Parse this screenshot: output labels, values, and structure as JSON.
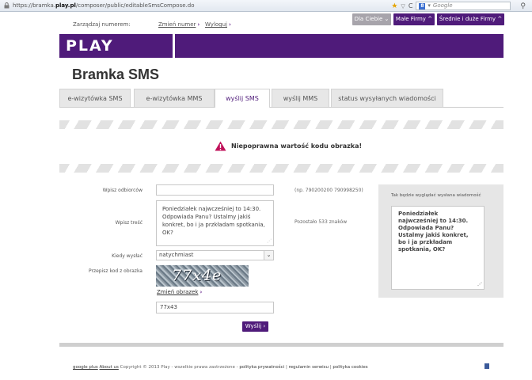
{
  "browser": {
    "url_prefix": "https://bramka.",
    "url_host": "play.pl",
    "url_path": "/composer/public/editableSmsCompose.do",
    "search_placeholder": "Google",
    "search_badge": "8"
  },
  "utility": {
    "manage_label": "Zarządzaj numerem:",
    "change_number": "Zmień numer",
    "logout": "Wyloguj",
    "segments": [
      "Dla Ciebie",
      "Małe Firmy",
      "Średnie i duże Firmy"
    ]
  },
  "brand": {
    "logo_text": "PLAY"
  },
  "page": {
    "title": "Bramka SMS"
  },
  "tabs": [
    "e-wizytówka SMS",
    "e-wizytówka MMS",
    "wyślij SMS",
    "wyślij MMS",
    "status wysyłanych wiadomości"
  ],
  "error": {
    "message": "Niepoprawna wartość kodu obrazka!"
  },
  "form": {
    "recipients_label": "Wpisz odbiorców",
    "recipients_value": "",
    "recipients_hint": "(np. 790200200 790998250)",
    "message_label": "Wpisz treść",
    "message_value": "Poniedziałek najwcześniej to 14:30. Odpowiada Panu? Ustalmy jakiś konkret, bo i ja przkładam spotkania, OK?",
    "remaining": "Pozostało 533  znaków",
    "when_label": "Kiedy wysłać",
    "when_value": "natychmiast",
    "captcha_label": "Przepisz kod z obrazka",
    "captcha_text": "77x4e",
    "change_image": "Zmień obrazek",
    "code_value": "77x43",
    "send_label": "Wyślij"
  },
  "preview": {
    "title": "Tak będzie wyglądać wysłana wiadomość",
    "text": "Poniedziałek najwcześniej to 14:30. Odpowiada Panu? Ustalmy jakiś konkret, bo i ja przkładam spotkania, OK?"
  },
  "footer": {
    "google_plus": "google plus",
    "about": "About us",
    "copyright": "Copyright © 2013 Play - wszelkie prawa zastrzeżone -",
    "privacy": "polityka prywatności",
    "sep1": " | ",
    "terms": "regulamin serwisu",
    "sep2": " | ",
    "cookies": "polityka cookies"
  },
  "colors": {
    "brand_purple": "#4f1b7a",
    "error_icon": "#c0125a"
  }
}
